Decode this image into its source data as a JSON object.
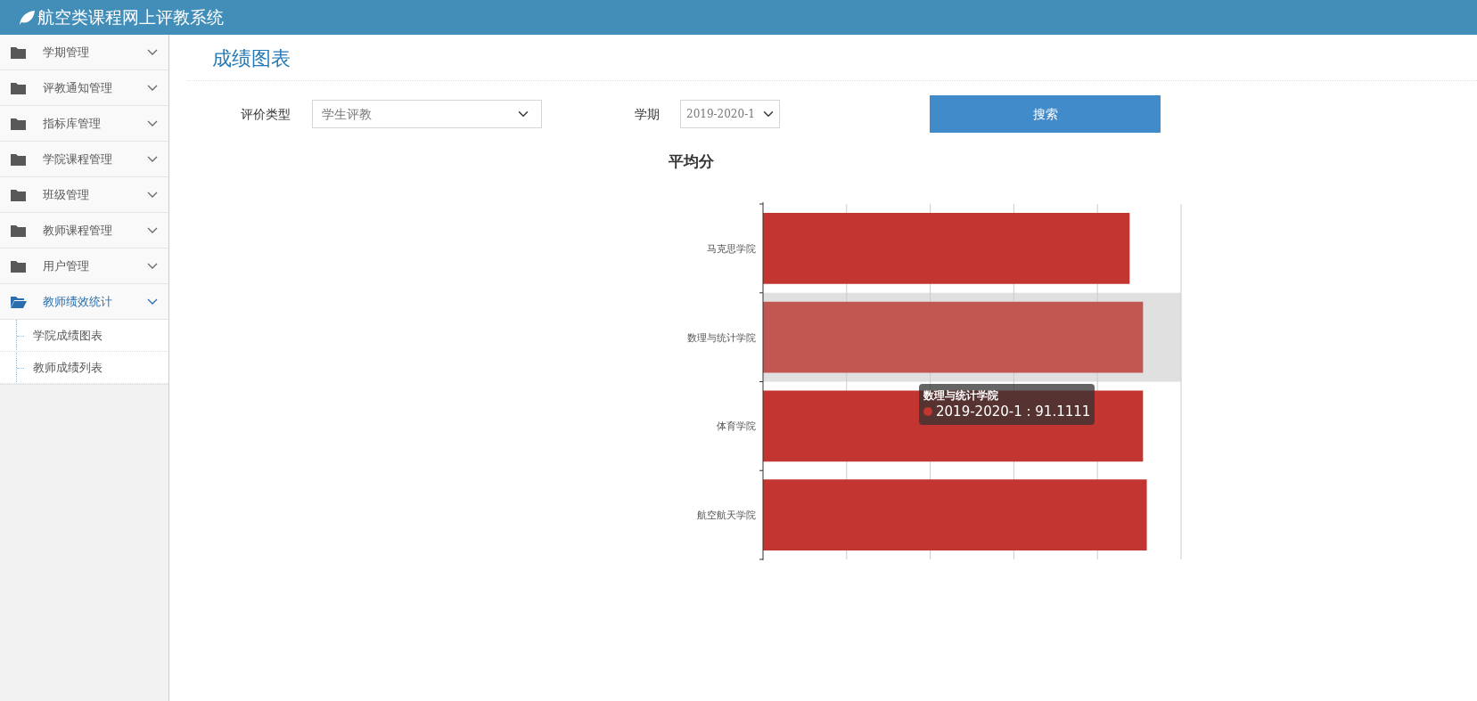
{
  "header": {
    "title": "航空类课程网上评教系统"
  },
  "sidebar": {
    "items": [
      {
        "label": "学期管理",
        "expanded": false,
        "selected": false
      },
      {
        "label": "评教通知管理",
        "expanded": false,
        "selected": false
      },
      {
        "label": "指标库管理",
        "expanded": false,
        "selected": false
      },
      {
        "label": "学院课程管理",
        "expanded": false,
        "selected": false
      },
      {
        "label": "班级管理",
        "expanded": false,
        "selected": false
      },
      {
        "label": "教师课程管理",
        "expanded": false,
        "selected": false
      },
      {
        "label": "用户管理",
        "expanded": false,
        "selected": false
      },
      {
        "label": "教师绩效统计",
        "expanded": true,
        "selected": true,
        "children": [
          {
            "label": "学院成绩图表"
          },
          {
            "label": "教师成绩列表"
          }
        ]
      }
    ]
  },
  "page_title": "成绩图表",
  "filters": [
    {
      "label": "评价类型",
      "value": "学生评教",
      "kind": "wide"
    },
    {
      "label": "学期",
      "value": "2019-2020-1",
      "kind": "narrow"
    }
  ],
  "search_button": "搜索",
  "chart": {
    "title": "平均分",
    "rows": [
      {
        "label": "马克思学院",
        "selected": false
      },
      {
        "label": "数理与统计学院",
        "selected": true
      },
      {
        "label": "体育学院",
        "selected": false
      },
      {
        "label": "航空航天学院",
        "selected": false
      }
    ],
    "tooltip": {
      "title": "数理与统计学院",
      "text": "2019-2020-1 : 91.1111",
      "color": "#c23531"
    }
  }
}
